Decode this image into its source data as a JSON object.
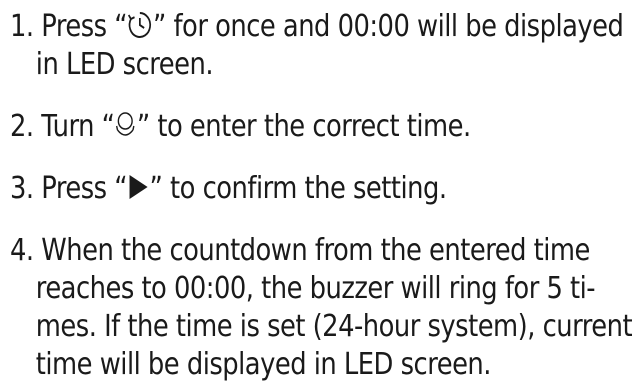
{
  "steps": [
    {
      "number": "1.",
      "pre": "Press “",
      "icon": "timer-icon",
      "post": "” for once and 00:00 will be displayed",
      "line2": "in LED screen."
    },
    {
      "number": "2.",
      "pre": "Turn “",
      "icon": "knob-icon",
      "post": "” to enter the correct time."
    },
    {
      "number": "3.",
      "pre": "Press “",
      "icon": "start-triangle-icon",
      "post": "” to confirm the setting."
    },
    {
      "number": "4.",
      "lines": [
        "When the countdown from the entered time",
        "reaches to 00:00, the buzzer will ring for 5 ti-",
        "mes. If the time is set (24-hour system), current",
        "time will be displayed in LED screen."
      ]
    }
  ]
}
